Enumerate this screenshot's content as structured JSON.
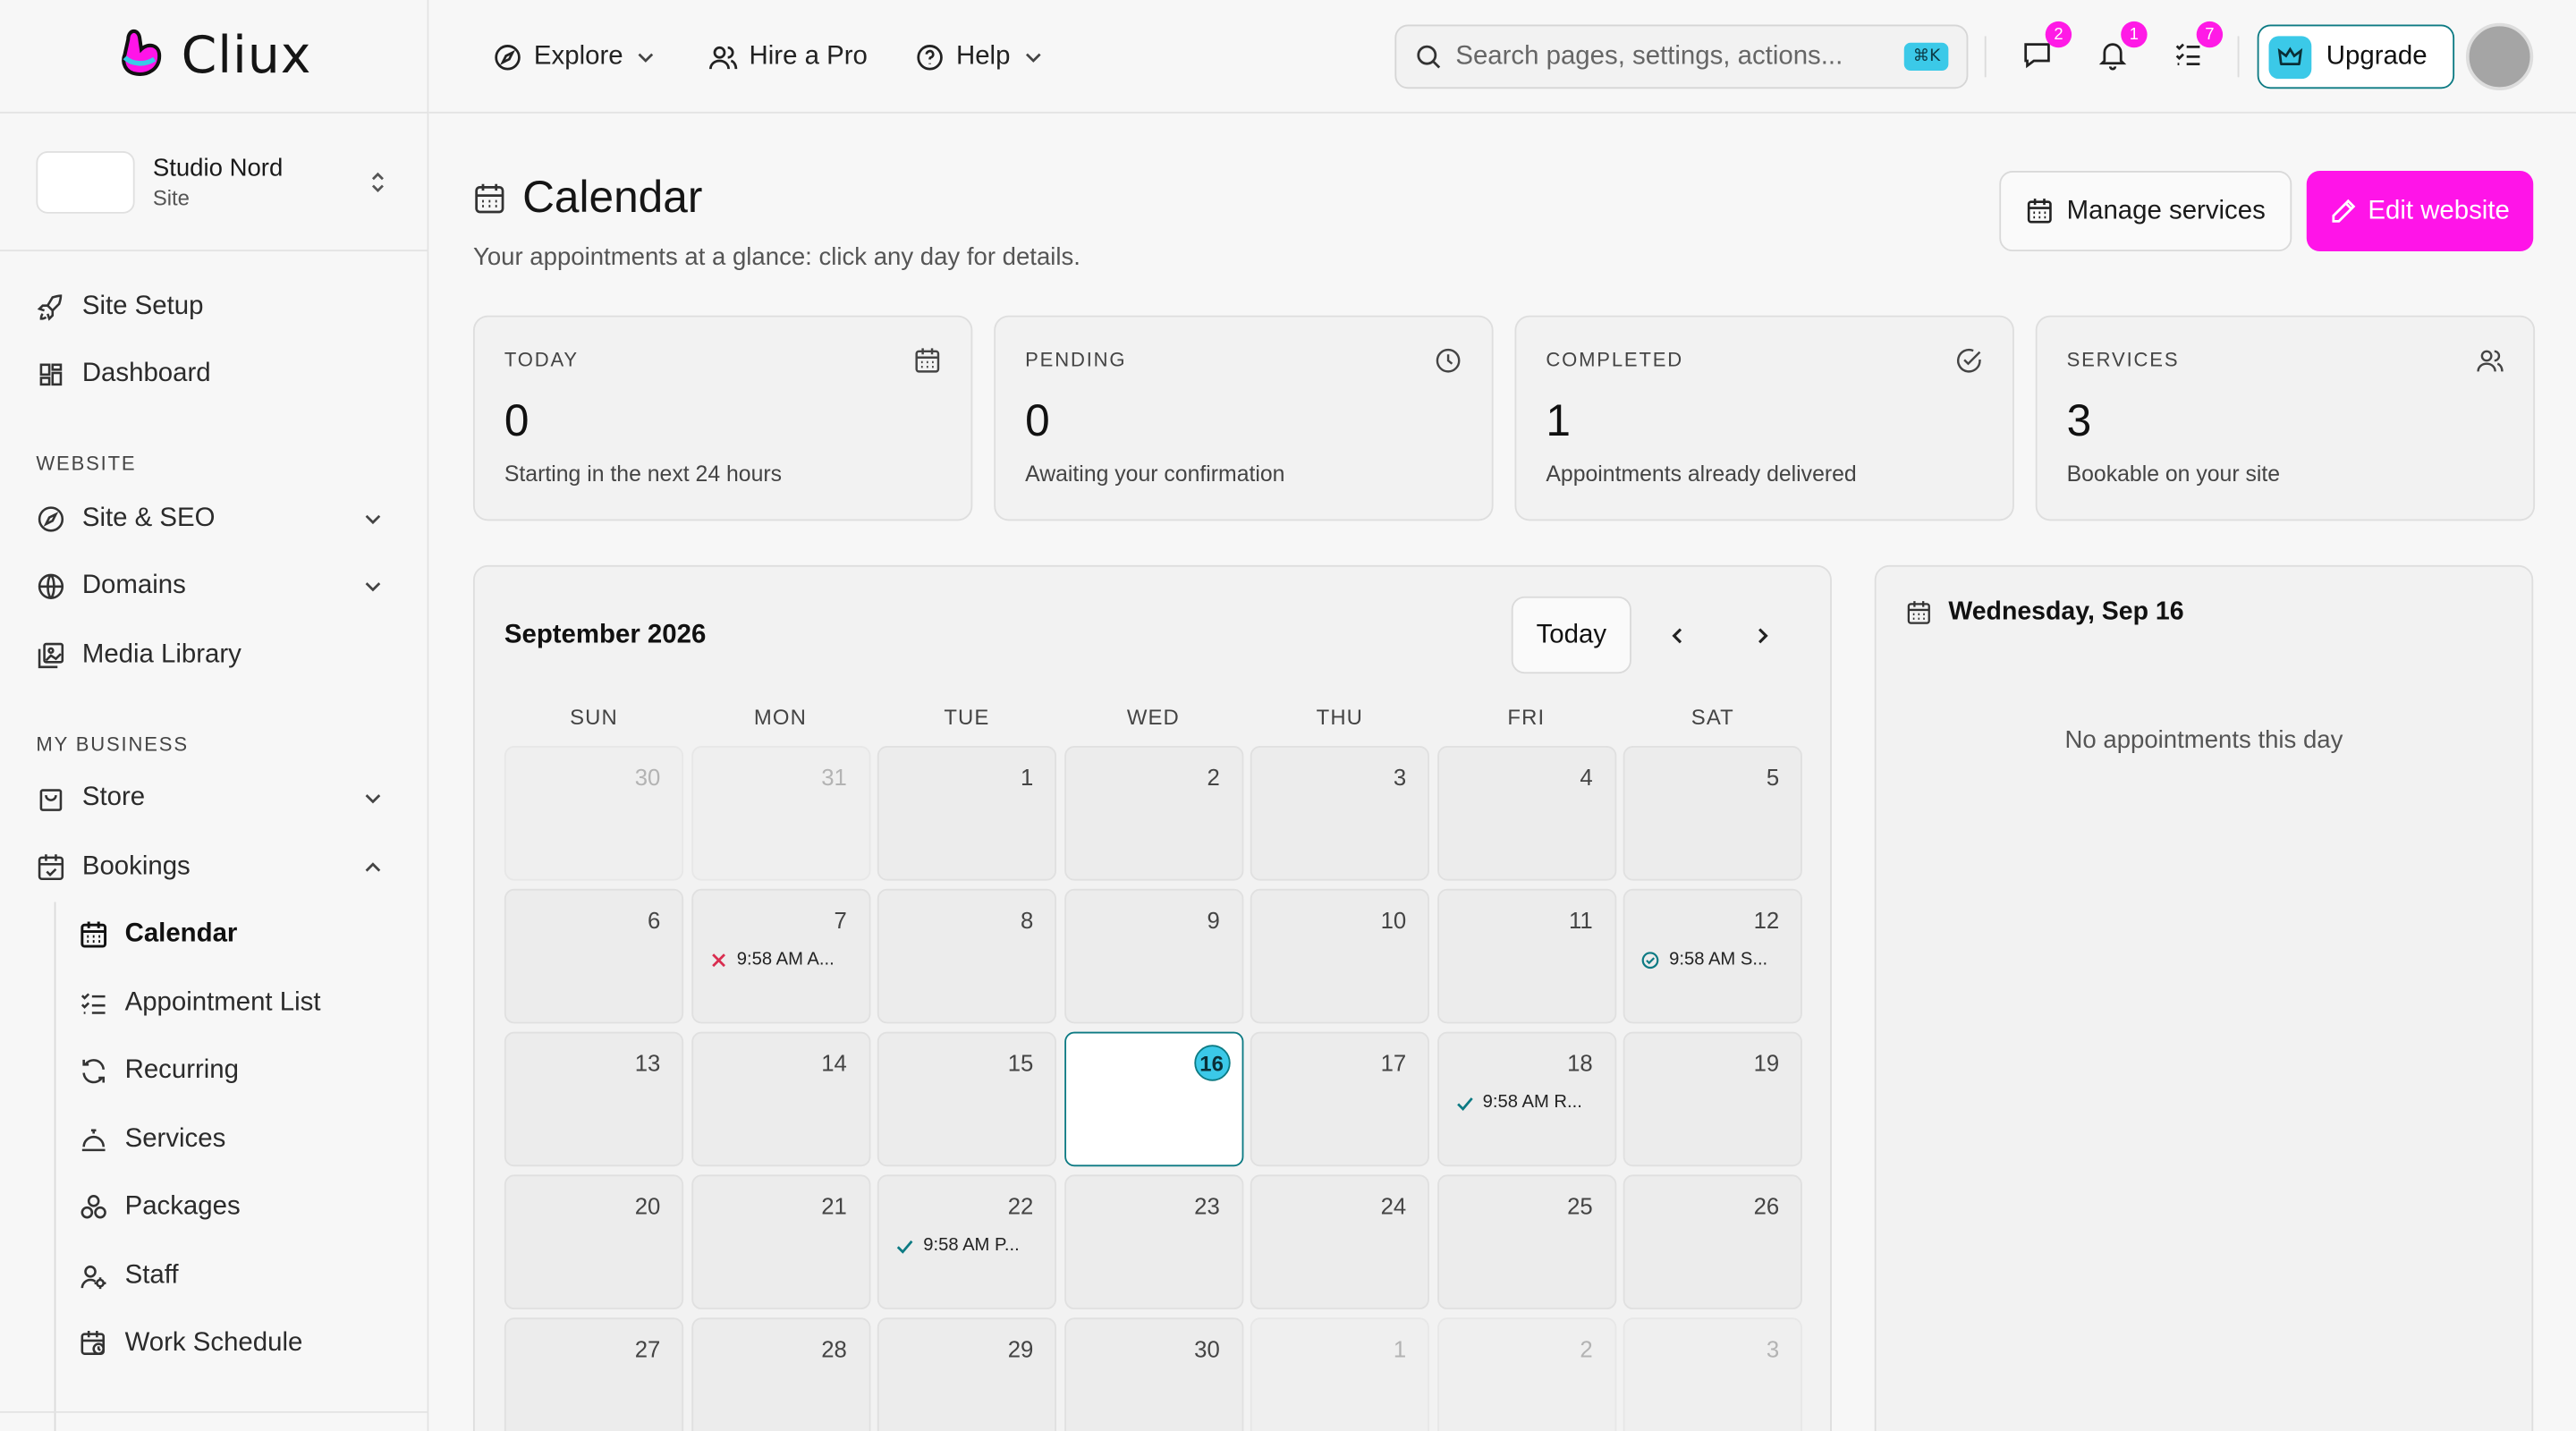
{
  "brand": {
    "name": "Cliux"
  },
  "site": {
    "name": "Studio Nord",
    "type": "Site"
  },
  "sidebar": {
    "top_items": [
      {
        "label": "Site Setup",
        "icon": "rocket-icon"
      },
      {
        "label": "Dashboard",
        "icon": "dashboard-icon"
      }
    ],
    "section_website": "WEBSITE",
    "website_items": [
      {
        "label": "Site & SEO",
        "icon": "compass-icon"
      },
      {
        "label": "Domains",
        "icon": "globe-icon"
      },
      {
        "label": "Media Library",
        "icon": "image-icon"
      }
    ],
    "section_business": "MY BUSINESS",
    "business_items": [
      {
        "label": "Store",
        "icon": "bag-icon"
      },
      {
        "label": "Bookings",
        "icon": "calendar-check-icon"
      }
    ],
    "bookings_sub": [
      {
        "label": "Calendar",
        "icon": "calendar-icon",
        "active": true
      },
      {
        "label": "Appointment List",
        "icon": "checklist-icon"
      },
      {
        "label": "Recurring",
        "icon": "refresh-icon"
      },
      {
        "label": "Services",
        "icon": "bell-service-icon"
      },
      {
        "label": "Packages",
        "icon": "packages-icon"
      },
      {
        "label": "Staff",
        "icon": "staff-icon"
      },
      {
        "label": "Work Schedule",
        "icon": "schedule-icon"
      }
    ]
  },
  "topbar": {
    "explore": "Explore",
    "hire": "Hire a Pro",
    "help": "Help",
    "search_placeholder": "Search pages, settings, actions...",
    "search_shortcut": "⌘K",
    "messages_count": "2",
    "notifications_count": "1",
    "tasks_count": "7",
    "upgrade": "Upgrade"
  },
  "page": {
    "title": "Calendar",
    "subtitle": "Your appointments at a glance: click any day for details.",
    "manage_services": "Manage services",
    "edit_website": "Edit website"
  },
  "stats": [
    {
      "label": "TODAY",
      "value": "0",
      "desc": "Starting in the next 24 hours",
      "icon": "calendar-icon"
    },
    {
      "label": "PENDING",
      "value": "0",
      "desc": "Awaiting your confirmation",
      "icon": "clock-icon"
    },
    {
      "label": "COMPLETED",
      "value": "1",
      "desc": "Appointments already delivered",
      "icon": "check-circle-icon"
    },
    {
      "label": "SERVICES",
      "value": "3",
      "desc": "Bookable on your site",
      "icon": "users-icon"
    }
  ],
  "calendar": {
    "month": "September 2026",
    "today_label": "Today",
    "weekdays": [
      "SUN",
      "MON",
      "TUE",
      "WED",
      "THU",
      "FRI",
      "SAT"
    ],
    "days": [
      {
        "d": "30",
        "out": true
      },
      {
        "d": "31",
        "out": true
      },
      {
        "d": "1"
      },
      {
        "d": "2"
      },
      {
        "d": "3"
      },
      {
        "d": "4"
      },
      {
        "d": "5"
      },
      {
        "d": "6"
      },
      {
        "d": "7",
        "appt": "9:58 AM A...",
        "status": "cancelled"
      },
      {
        "d": "8"
      },
      {
        "d": "9"
      },
      {
        "d": "10"
      },
      {
        "d": "11"
      },
      {
        "d": "12",
        "appt": "9:58 AM S...",
        "status": "completed"
      },
      {
        "d": "13"
      },
      {
        "d": "14"
      },
      {
        "d": "15"
      },
      {
        "d": "16",
        "selected": true
      },
      {
        "d": "17"
      },
      {
        "d": "18",
        "appt": "9:58 AM R...",
        "status": "confirmed"
      },
      {
        "d": "19"
      },
      {
        "d": "20"
      },
      {
        "d": "21"
      },
      {
        "d": "22",
        "appt": "9:58 AM P...",
        "status": "confirmed"
      },
      {
        "d": "23"
      },
      {
        "d": "24"
      },
      {
        "d": "25"
      },
      {
        "d": "26"
      },
      {
        "d": "27"
      },
      {
        "d": "28"
      },
      {
        "d": "29"
      },
      {
        "d": "30"
      },
      {
        "d": "1",
        "out": true
      },
      {
        "d": "2",
        "out": true
      },
      {
        "d": "3",
        "out": true
      }
    ]
  },
  "day_panel": {
    "title": "Wednesday, Sep 16",
    "empty": "No appointments this day"
  },
  "colors": {
    "accent": "#ff14e8",
    "teal": "#0c7a83",
    "cyan": "#3bc9e8",
    "cancel": "#d92d4f"
  }
}
